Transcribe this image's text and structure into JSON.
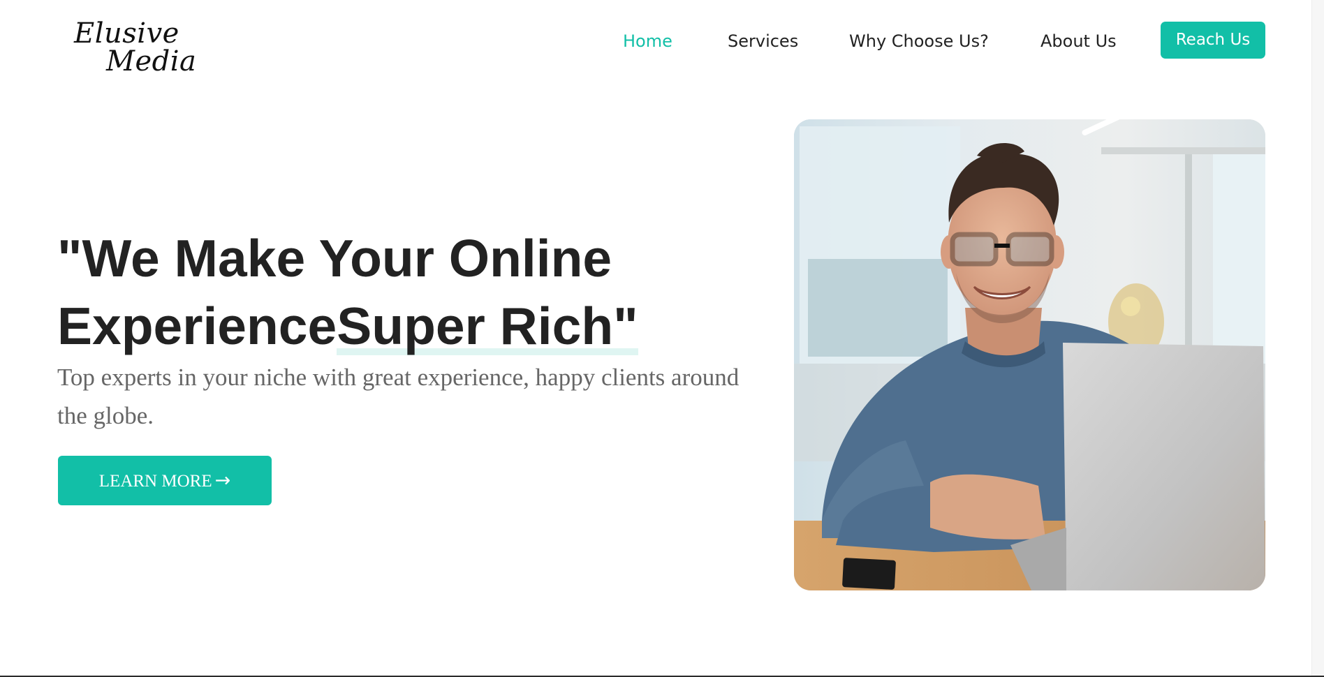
{
  "brand": {
    "logo_line1": "Elusive",
    "logo_line2": "Media",
    "accent_color": "#12bfa7",
    "text_color": "#222222"
  },
  "nav": {
    "items": [
      {
        "label": "Home",
        "active": true
      },
      {
        "label": "Services",
        "active": false
      },
      {
        "label": "Why Choose Us?",
        "active": false
      },
      {
        "label": "About Us",
        "active": false
      }
    ],
    "cta_label": "Reach Us"
  },
  "hero": {
    "heading_part1": "\"We Make Your Online Experience",
    "heading_highlight": "Super Rich\"",
    "subtitle": "Top experts in your niche with great experience, happy clients around the globe.",
    "button_label": "LEARN MORE",
    "button_icon": "arrow-right-icon",
    "image_alt": "smiling man with glasses using a laptop"
  }
}
